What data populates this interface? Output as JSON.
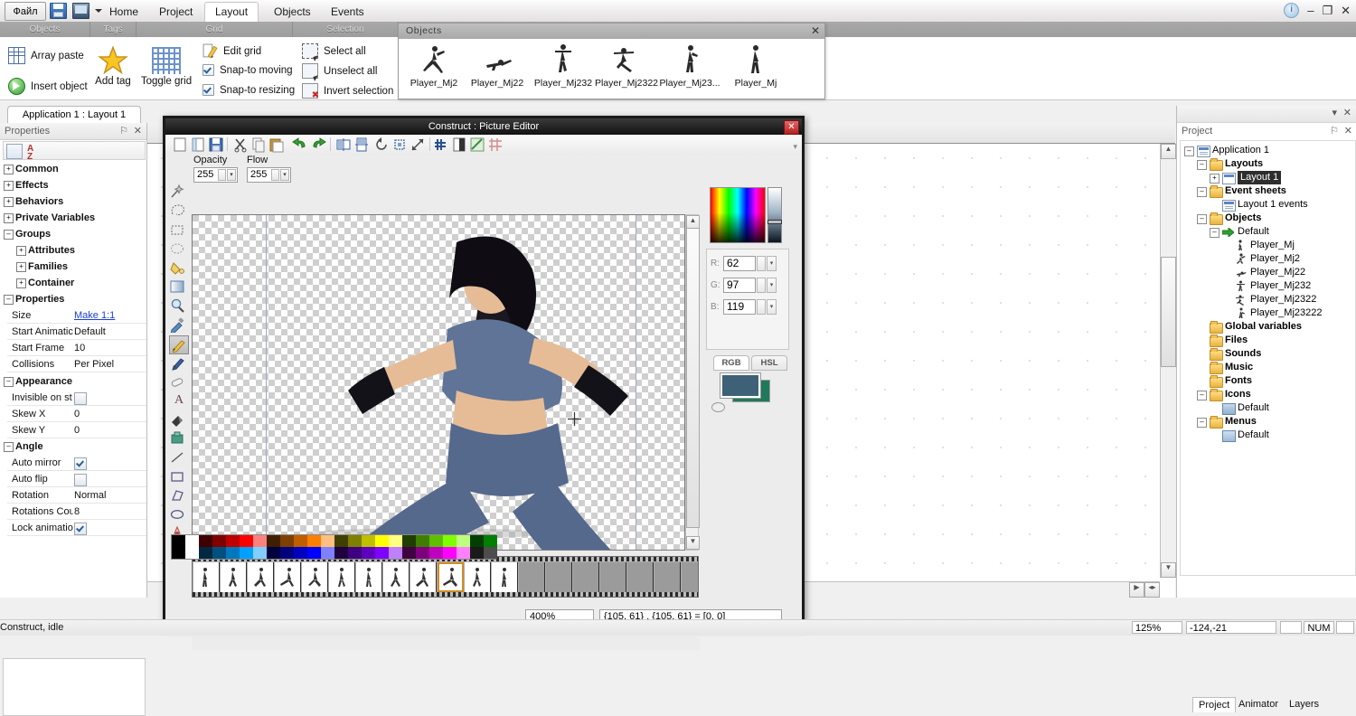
{
  "titlebar": {
    "file_button": "Файл",
    "tabs": [
      "Home",
      "Project",
      "Layout",
      "Objects",
      "Events"
    ],
    "active_tab": "Layout",
    "icons": {
      "save": "save-icon",
      "monitor": "monitor-icon",
      "dropdown": "chevron-down-icon",
      "info": "info-icon"
    },
    "window_controls": {
      "minimize": "–",
      "maximize": "❐",
      "close": "✕"
    }
  },
  "ribbon": {
    "groups": [
      "Objects",
      "Tags",
      "Grid",
      "Selection"
    ],
    "objects_group": [
      {
        "label": "Array paste",
        "icon": "array-icon"
      },
      {
        "label": "Insert object",
        "icon": "insert-object-icon"
      }
    ],
    "tags_group": [
      {
        "label": "Add tag",
        "icon": "star-icon"
      }
    ],
    "grid_group_big": [
      {
        "label": "Toggle grid",
        "icon": "grid-icon"
      }
    ],
    "grid_group": [
      {
        "label": "Edit grid",
        "type": "button",
        "checked": false
      },
      {
        "label": "Snap-to moving",
        "type": "check",
        "checked": true
      },
      {
        "label": "Snap-to resizing",
        "type": "check",
        "checked": true
      }
    ],
    "selection_group": [
      {
        "label": "Select all",
        "icon": "select-all-icon"
      },
      {
        "label": "Unselect all",
        "icon": "unselect-all-icon"
      },
      {
        "label": "Invert selection",
        "icon": "invert-selection-icon"
      }
    ]
  },
  "objects_panel": {
    "title": "Objects",
    "close": "✕",
    "items": [
      {
        "name": "Player_Mj2"
      },
      {
        "name": "Player_Mj22"
      },
      {
        "name": "Player_Mj232"
      },
      {
        "name": "Player_Mj2322"
      },
      {
        "name": "Player_Mj23..."
      },
      {
        "name": "Player_Mj"
      }
    ]
  },
  "properties": {
    "document_tab": "Application 1 : Layout 1",
    "title": "Properties",
    "pin": "⚐",
    "close": "✕",
    "toolbar": {
      "categorized": "categorized-icon",
      "alphabetical": "A-Z"
    },
    "categories": [
      {
        "label": "Common",
        "expanded": false,
        "indent": 0
      },
      {
        "label": "Effects",
        "expanded": false,
        "indent": 0
      },
      {
        "label": "Behaviors",
        "expanded": false,
        "indent": 0
      },
      {
        "label": "Private Variables",
        "expanded": false,
        "indent": 0
      },
      {
        "label": "Groups",
        "expanded": true,
        "indent": 0
      },
      {
        "label": "Attributes",
        "expanded": false,
        "indent": 1
      },
      {
        "label": "Families",
        "expanded": false,
        "indent": 1
      },
      {
        "label": "Container",
        "expanded": false,
        "indent": 1
      },
      {
        "label": "Properties",
        "expanded": true,
        "indent": 0
      }
    ],
    "rows_properties": [
      {
        "name": "Size",
        "value": "Make 1:1",
        "link": true
      },
      {
        "name": "Start Animatic",
        "value": "Default"
      },
      {
        "name": "Start Frame",
        "value": "10"
      },
      {
        "name": "Collisions",
        "value": "Per Pixel"
      }
    ],
    "appearance_header": "Appearance",
    "rows_appearance": [
      {
        "name": "Invisible on st",
        "value": "",
        "checkbox": false
      },
      {
        "name": "Skew X",
        "value": "0"
      },
      {
        "name": "Skew Y",
        "value": "0"
      }
    ],
    "angle_header": "Angle",
    "rows_angle": [
      {
        "name": "Auto mirror",
        "value": "",
        "checkbox": true
      },
      {
        "name": "Auto flip",
        "value": "",
        "checkbox": false
      },
      {
        "name": "Rotation",
        "value": "Normal"
      },
      {
        "name": "Rotations Cou",
        "value": "8"
      },
      {
        "name": "Lock animatior",
        "value": "",
        "checkbox": true
      }
    ]
  },
  "picture_editor": {
    "title": "Construct : Picture Editor",
    "close": "✕",
    "toolbar_icons": [
      "new-icon",
      "open-icon",
      "save-icon",
      "cut-icon",
      "copy-icon",
      "paste-icon",
      "undo-icon",
      "redo-icon",
      "flip-horizontal-icon",
      "flip-vertical-icon",
      "rotate-icon",
      "crop-icon",
      "resize-icon",
      "tile-icon",
      "alpha-icon",
      "transparency-icon",
      "grid-icon"
    ],
    "opacity_label": "Opacity",
    "opacity_value": "255",
    "flow_label": "Flow",
    "flow_value": "255",
    "tools": [
      "magic-wand-icon",
      "lasso-icon",
      "rect-select-icon",
      "ellipse-select-icon",
      "bucket-icon",
      "gradient-icon",
      "zoom-icon",
      "eyedropper-icon",
      "pencil-icon",
      "brush-icon",
      "eraser-icon",
      "text-icon",
      "fill-icon",
      "stamp-icon",
      "line-icon",
      "rectangle-icon",
      "polygon-icon",
      "ellipse-icon",
      "hotspot-icon",
      "imagepoint-icon"
    ],
    "selected_tool": "pencil-icon",
    "color": {
      "r_label": "R:",
      "r_value": "62",
      "g_label": "G:",
      "g_value": "97",
      "b_label": "B:",
      "b_value": "119",
      "mode_tabs": [
        "RGB",
        "HSL"
      ],
      "active_mode": "RGB",
      "foreground_hex": "#3e6177",
      "background_hex": "#1e7a5a"
    },
    "frames": {
      "total_slots": 19,
      "filled": 12,
      "selected_index": 9
    },
    "status": {
      "zoom": "400%",
      "coords": "{105, 61} , {105, 61} = [0, 0]"
    }
  },
  "layout": {
    "zoom_indicator": "125%",
    "selection_coords": "-124,-21",
    "num_lock": "NUM"
  },
  "project": {
    "title": "Project",
    "pin": "⚐",
    "close": "✕",
    "tree": [
      {
        "label": "Application 1",
        "depth": 0,
        "expander": "-",
        "icon": "application-icon",
        "bold": false
      },
      {
        "label": "Layouts",
        "depth": 1,
        "expander": "-",
        "icon": "folder-icon",
        "bold": true
      },
      {
        "label": "Layout 1",
        "depth": 2,
        "expander": "+",
        "icon": "layout-icon",
        "bold": false,
        "selected": true
      },
      {
        "label": "Event sheets",
        "depth": 1,
        "expander": "-",
        "icon": "folder-icon",
        "bold": true
      },
      {
        "label": "Layout 1 events",
        "depth": 2,
        "expander": "",
        "icon": "eventsheet-icon",
        "bold": false
      },
      {
        "label": "Objects",
        "depth": 1,
        "expander": "-",
        "icon": "folder-icon",
        "bold": true
      },
      {
        "label": "Default",
        "depth": 2,
        "expander": "-",
        "icon": "green-arrow-icon",
        "bold": false
      },
      {
        "label": "Player_Mj",
        "depth": 3,
        "expander": "",
        "icon": "sprite-icon",
        "bold": false
      },
      {
        "label": "Player_Mj2",
        "depth": 3,
        "expander": "",
        "icon": "sprite-icon",
        "bold": false
      },
      {
        "label": "Player_Mj22",
        "depth": 3,
        "expander": "",
        "icon": "sprite-icon",
        "bold": false
      },
      {
        "label": "Player_Mj232",
        "depth": 3,
        "expander": "",
        "icon": "sprite-icon",
        "bold": false
      },
      {
        "label": "Player_Mj2322",
        "depth": 3,
        "expander": "",
        "icon": "sprite-icon",
        "bold": false
      },
      {
        "label": "Player_Mj23222",
        "depth": 3,
        "expander": "",
        "icon": "sprite-icon",
        "bold": false
      },
      {
        "label": "Global variables",
        "depth": 1,
        "expander": "",
        "icon": "folder-icon",
        "bold": true
      },
      {
        "label": "Files",
        "depth": 1,
        "expander": "",
        "icon": "folder-icon",
        "bold": true
      },
      {
        "label": "Sounds",
        "depth": 1,
        "expander": "",
        "icon": "folder-icon",
        "bold": true
      },
      {
        "label": "Music",
        "depth": 1,
        "expander": "",
        "icon": "folder-icon",
        "bold": true
      },
      {
        "label": "Fonts",
        "depth": 1,
        "expander": "",
        "icon": "folder-icon",
        "bold": true
      },
      {
        "label": "Icons",
        "depth": 1,
        "expander": "-",
        "icon": "folder-icon",
        "bold": true
      },
      {
        "label": "Default",
        "depth": 2,
        "expander": "",
        "icon": "icon-file-icon",
        "bold": false
      },
      {
        "label": "Menus",
        "depth": 1,
        "expander": "-",
        "icon": "folder-icon",
        "bold": true
      },
      {
        "label": "Default",
        "depth": 2,
        "expander": "",
        "icon": "menu-file-icon",
        "bold": false
      }
    ],
    "tabs": [
      "Project",
      "Animator",
      "Layers"
    ],
    "active_tab": "Project"
  },
  "statusbar": {
    "message": "Construct, idle"
  }
}
